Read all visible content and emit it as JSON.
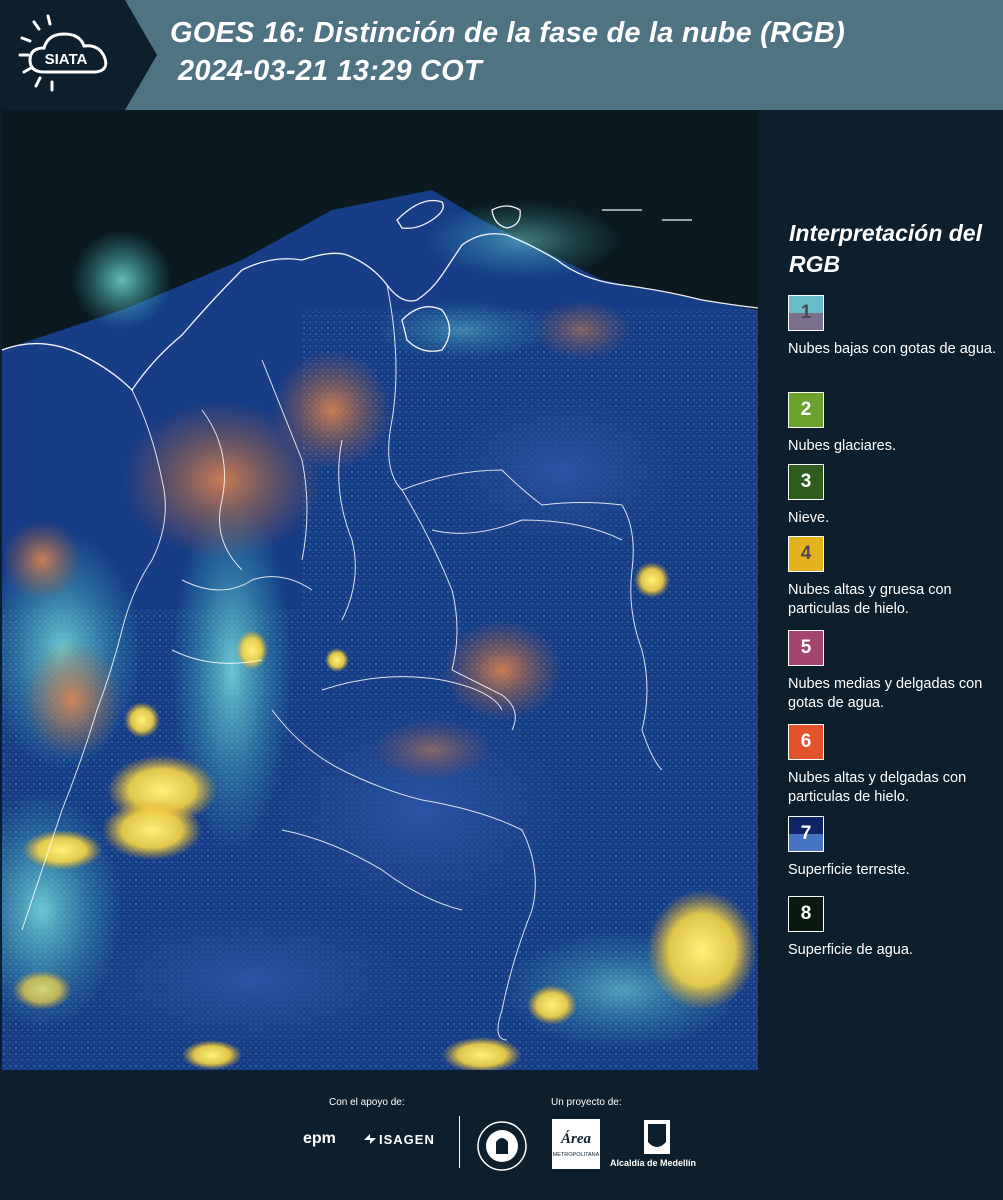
{
  "header": {
    "logo_text": "SIATA",
    "title_line1": "GOES 16: Distinción de la fase de la nube (RGB)",
    "title_line2": "2024-03-21 13:29 COT",
    "background_color": "#4e7383"
  },
  "legend": {
    "title": "Interpretación del RGB",
    "items": [
      {
        "number": "1",
        "label": "Nubes bajas con gotas de agua.",
        "color_top": "#6bbcc9",
        "color_bottom": "#7a6f8d"
      },
      {
        "number": "2",
        "label": "Nubes glaciares.",
        "color_top": "#6aa22c",
        "color_bottom": "#6aa22c"
      },
      {
        "number": "3",
        "label": "Nieve.",
        "color_top": "#2d5c1c",
        "color_bottom": "#2d5c1c"
      },
      {
        "number": "4",
        "label": "Nubes altas y gruesa con particulas de hielo.",
        "color_top": "#e4b21c",
        "color_bottom": "#e4b21c"
      },
      {
        "number": "5",
        "label": "Nubes medias y delgadas con gotas de agua.",
        "color_top": "#a3456f",
        "color_bottom": "#a3456f"
      },
      {
        "number": "6",
        "label": "Nubes altas y delgadas con particulas de hielo.",
        "color_top": "#e2532b",
        "color_bottom": "#e2532b"
      },
      {
        "number": "7",
        "label": "Superficie terreste.",
        "color_top": "#0f2566",
        "color_bottom": "#4773c3"
      },
      {
        "number": "8",
        "label": "Superficie de agua.",
        "color_top": "#0a1a10",
        "color_bottom": "#0a1a10"
      }
    ]
  },
  "footer": {
    "support_label": "Con el apoyo de:",
    "project_label": "Un proyecto de:",
    "epm_logo": "epm",
    "isagen_logo": "ISAGEN",
    "area_logo": "Área",
    "area_sub": "METROPOLITANA",
    "alcaldia_logo": "Alcaldía de Medellín"
  },
  "map": {
    "description_icon": "satellite-rgb-image"
  }
}
